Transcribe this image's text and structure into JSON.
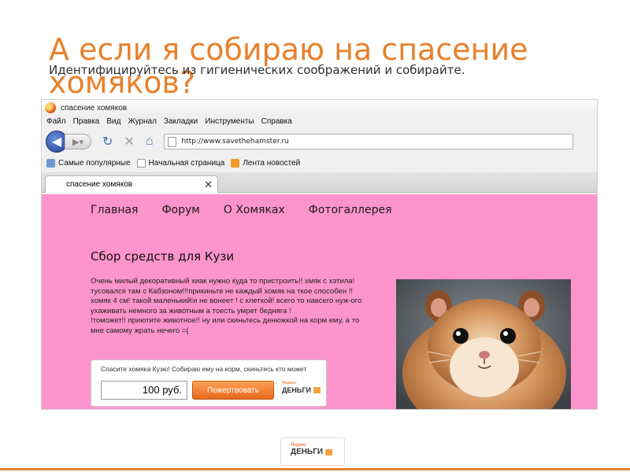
{
  "slide": {
    "title": "А если я собираю на спасение хомяков?",
    "subtitle": "Идентифицируйтесь из гигиенических соображений и собирайте.",
    "colors": {
      "accent": "#e8812b",
      "site_bg": "#fd94cc"
    }
  },
  "browser": {
    "window_title": "спасение хомяков",
    "menu": [
      "Файл",
      "Правка",
      "Вид",
      "Журнал",
      "Закладки",
      "Инструменты",
      "Справка"
    ],
    "url": "http://www.savethehamster.ru",
    "bookmarks": [
      "Самые популярные",
      "Начальная страница",
      "Лента новостей"
    ],
    "tab_title": "спасение хомяков",
    "icons": [
      "firefox-logo-icon",
      "back-arrow-icon",
      "forward-arrow-icon",
      "reload-icon",
      "stop-icon",
      "home-icon",
      "page-icon",
      "rss-icon",
      "close-icon"
    ]
  },
  "site": {
    "nav": [
      "Главная",
      "Форум",
      "О Хомяках",
      "Фотогаллерея"
    ],
    "heading": "Сбор средств для Кузи",
    "paragraph": "Очень милый декоративный хиак нужно куда то пристроить!! хмяк с хэтила! тусовался там с Кабзоном!!!прикиньте не каждый хомяк на ткое способен !! хомяк 4 см! такой маленький!и не вонеет ! с клеткой! всего то навсего нуж-ого ухаживать немного за животным а тоесть умрет бедняга !\n!томожет!! приютите животное!! ну или скиньтесь денюжкой на корм ему, а то мне самому жрать нечего =(",
    "widget": {
      "caption": "Спасите хомяка Кузю! Собираю ему на корм, скиньтесь кто может",
      "amount": "100 руб.",
      "button": "Пожертвовать",
      "logo_small": "Яндекс",
      "logo_big": "ДЕНЬГИ"
    }
  },
  "footer_logo": {
    "small": "Яндекс",
    "big": "ДЕНЬГИ"
  }
}
